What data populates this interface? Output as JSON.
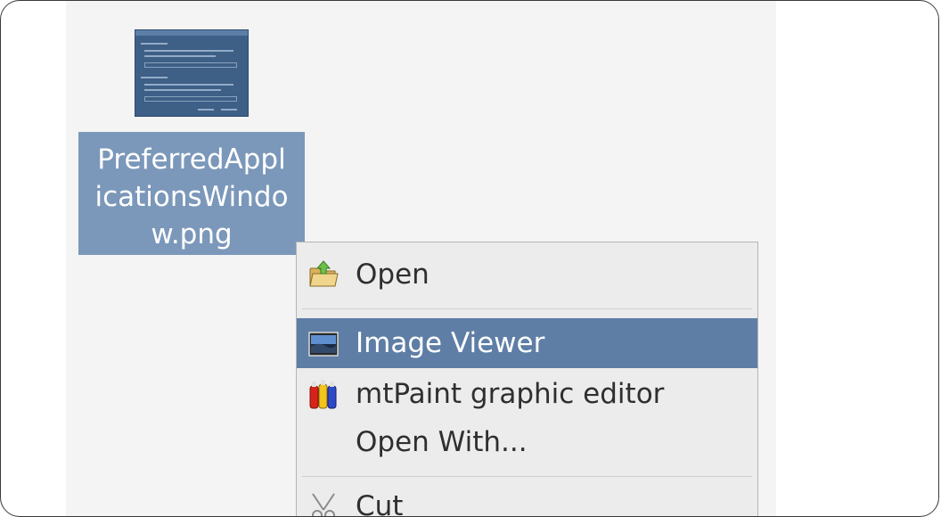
{
  "file": {
    "name": "PreferredApplicationsWindow.png",
    "line1": "PreferredAppl",
    "line2": "icationsWindo",
    "line3": "w.png",
    "thumbnail_icon": "image-thumbnail"
  },
  "menu": {
    "items": [
      {
        "label": "Open",
        "icon": "open-folder-icon"
      },
      {
        "label": "Image Viewer",
        "icon": "image-viewer-icon",
        "selected": true
      },
      {
        "label": "mtPaint graphic editor",
        "icon": "mtpaint-icon"
      },
      {
        "label": "Open With...",
        "icon": ""
      },
      {
        "label": "Cut",
        "icon": "cut-icon"
      }
    ]
  },
  "colors": {
    "selection": "#5e7ea6",
    "file_label_bg": "#7b98ba",
    "menu_bg": "#ececec"
  }
}
